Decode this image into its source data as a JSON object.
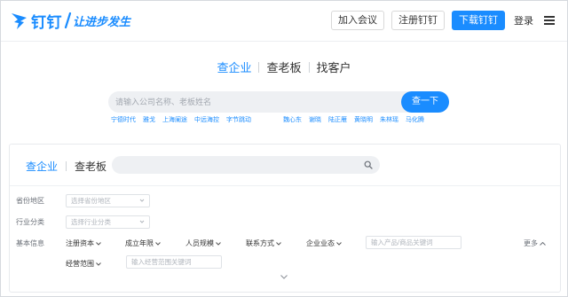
{
  "header": {
    "brand": "钉钉",
    "slogan": "让进步发生",
    "buttons": [
      "加入会议",
      "注册钉钉",
      "下载钉钉"
    ],
    "login": "登录",
    "accent": "#1a8cff"
  },
  "hero": {
    "tabs": [
      "查企业",
      "查老板",
      "找客户"
    ],
    "active_tab": "查企业",
    "search_placeholder": "请输入公司名称、老板姓名",
    "search_button": "查一下",
    "hot_companies": [
      "宁德时代",
      "雅戈",
      "上海阑途",
      "中远海控",
      "字节跳动"
    ],
    "hot_people": [
      "魏心东",
      "谢晓",
      "陆正雁",
      "黄晓明",
      "朱林瑶",
      "马化腾"
    ]
  },
  "panel": {
    "tabs": [
      "查企业",
      "查老板"
    ],
    "active_tab": "查企业",
    "region_label": "省份地区",
    "region_placeholder": "选择省份地区",
    "industry_label": "行业分类",
    "industry_placeholder": "选择行业分类",
    "basic_label": "基本信息",
    "filters": [
      "注册资本",
      "成立年限",
      "人员规模",
      "联系方式",
      "企业业态"
    ],
    "product_placeholder": "输入产品/商品关键词",
    "more": "更多",
    "scope_label": "经营范围",
    "scope_placeholder": "输入经营范围关键词"
  }
}
